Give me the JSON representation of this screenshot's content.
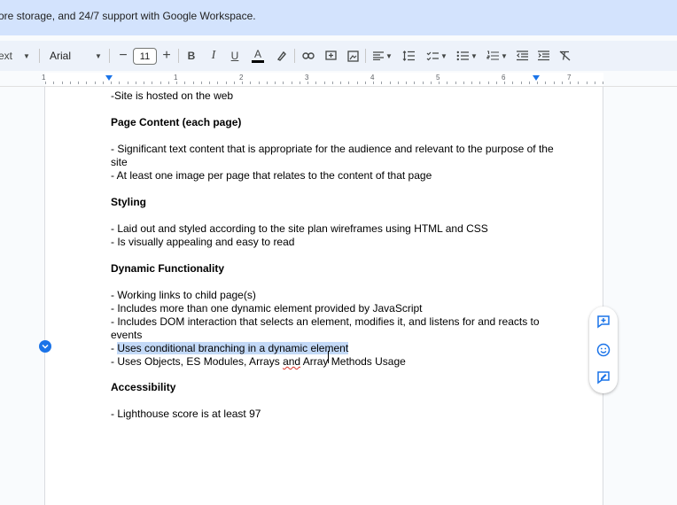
{
  "banner": {
    "text": "ore storage, and 24/7 support with Google Workspace."
  },
  "toolbar": {
    "style_label": "ext",
    "font_label": "Arial",
    "font_size": "11",
    "minus": "−",
    "plus": "+",
    "bold": "B",
    "italic": "I",
    "underline": "U",
    "text_color": "A"
  },
  "ruler": {
    "numbers": [
      "1",
      "1",
      "2",
      "3",
      "4",
      "5",
      "6",
      "7"
    ]
  },
  "document": {
    "lines": [
      "-Site is hosted on the web",
      "Page Content (each page)",
      "- Significant text content that is appropriate for the audience and relevant to the purpose of the",
      "site",
      "- At least one image per page that relates to the content of that page",
      "Styling",
      "- Laid out and styled according to the site plan wireframes using HTML and CSS",
      "- Is visually appealing and easy to read",
      "Dynamic Functionality",
      "- Working links to child page(s)",
      "- Includes more than one dynamic element provided by JavaScript",
      "- Includes DOM interaction that selects an element, modifies it, and listens for and reacts to",
      "events",
      "- ",
      "Uses conditional branching in a dynamic element",
      "- Uses Objects, ES Modules, Arrays ",
      "and",
      " Array Methods Usage",
      "Accessibility",
      "- Lighthouse score is at least 97"
    ]
  },
  "colors": {
    "accent": "#1a73e8",
    "banner": "#d3e3fd",
    "toolbar": "#edf2fa",
    "highlight": "#c3d9f7"
  },
  "side_panel": {
    "icons": [
      "add-comment-icon",
      "add-emoji-icon",
      "suggest-edits-icon"
    ]
  }
}
